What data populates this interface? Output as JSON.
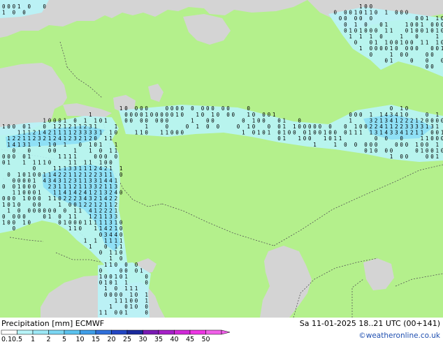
{
  "legend": {
    "title": "Precipitation [mm] ECMWF",
    "bins": [
      {
        "label": "0.1",
        "color": "#ffffff"
      },
      {
        "label": "0.5",
        "color": "#b8f4f8"
      },
      {
        "label": "1",
        "color": "#9ce8f6"
      },
      {
        "label": "2",
        "color": "#7bd6f2"
      },
      {
        "label": "5",
        "color": "#5ac2ee"
      },
      {
        "label": "10",
        "color": "#3f9ee8"
      },
      {
        "label": "15",
        "color": "#2f6fda"
      },
      {
        "label": "20",
        "color": "#2346c4"
      },
      {
        "label": "25",
        "color": "#1a2a9c"
      },
      {
        "label": "30",
        "color": "#7a1ab4"
      },
      {
        "label": "35",
        "color": "#a620c8"
      },
      {
        "label": "40",
        "color": "#d028d8"
      },
      {
        "label": "45",
        "color": "#ee36e4"
      },
      {
        "label": "50",
        "color": "#f060e8"
      }
    ]
  },
  "run_label": "Sa 11-01-2025 18..21 UTC (00+141)",
  "credit": "©weatheronline.co.uk",
  "colors": {
    "land": "#b4f08c",
    "sea": "#d4d4d4",
    "border": "#555555",
    "light_precip": "#b8f4f8",
    "moderate_precip": "#8fe0f6"
  }
}
